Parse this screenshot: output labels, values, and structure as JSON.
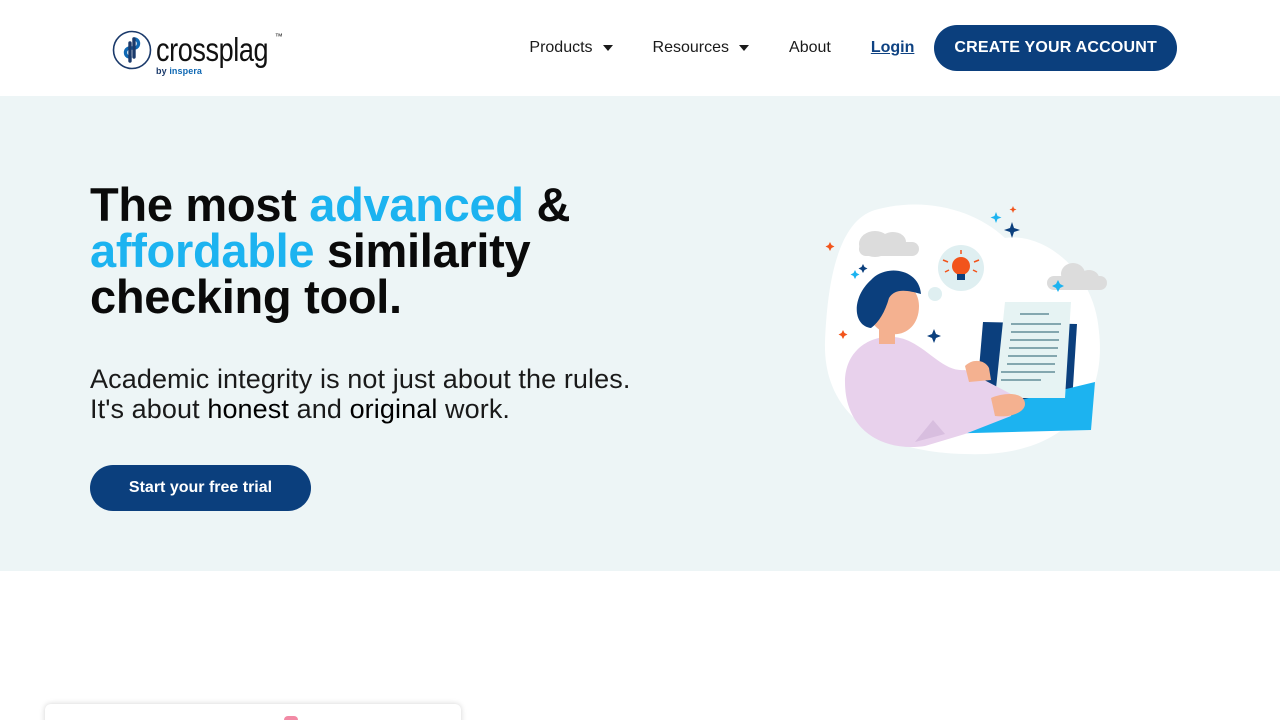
{
  "brand": {
    "name": "crossplag",
    "trademark": "™",
    "byline_prefix": "by",
    "byline_company": "inspera",
    "colors": {
      "primary": "#0b3f7d",
      "accent": "#1cb3f0",
      "hero_bg": "#edf5f6"
    }
  },
  "nav": {
    "products": "Products",
    "resources": "Resources",
    "about": "About",
    "login": "Login",
    "cta": "CREATE YOUR ACCOUNT"
  },
  "hero": {
    "title_part1": "The most ",
    "title_accent1": "advanced",
    "title_part2": " & ",
    "title_accent2": "affordable",
    "title_part3": " similarity checking tool.",
    "sub_part1": "Academic integrity is not just about the rules. It's about ",
    "sub_em1": "honest",
    "sub_part2": " and ",
    "sub_em2": "original",
    "sub_part3": " work.",
    "button": "Start your free trial"
  },
  "icons": [
    "crossplag-logo-icon",
    "chevron-down-icon",
    "woman-laptop-illustration"
  ]
}
